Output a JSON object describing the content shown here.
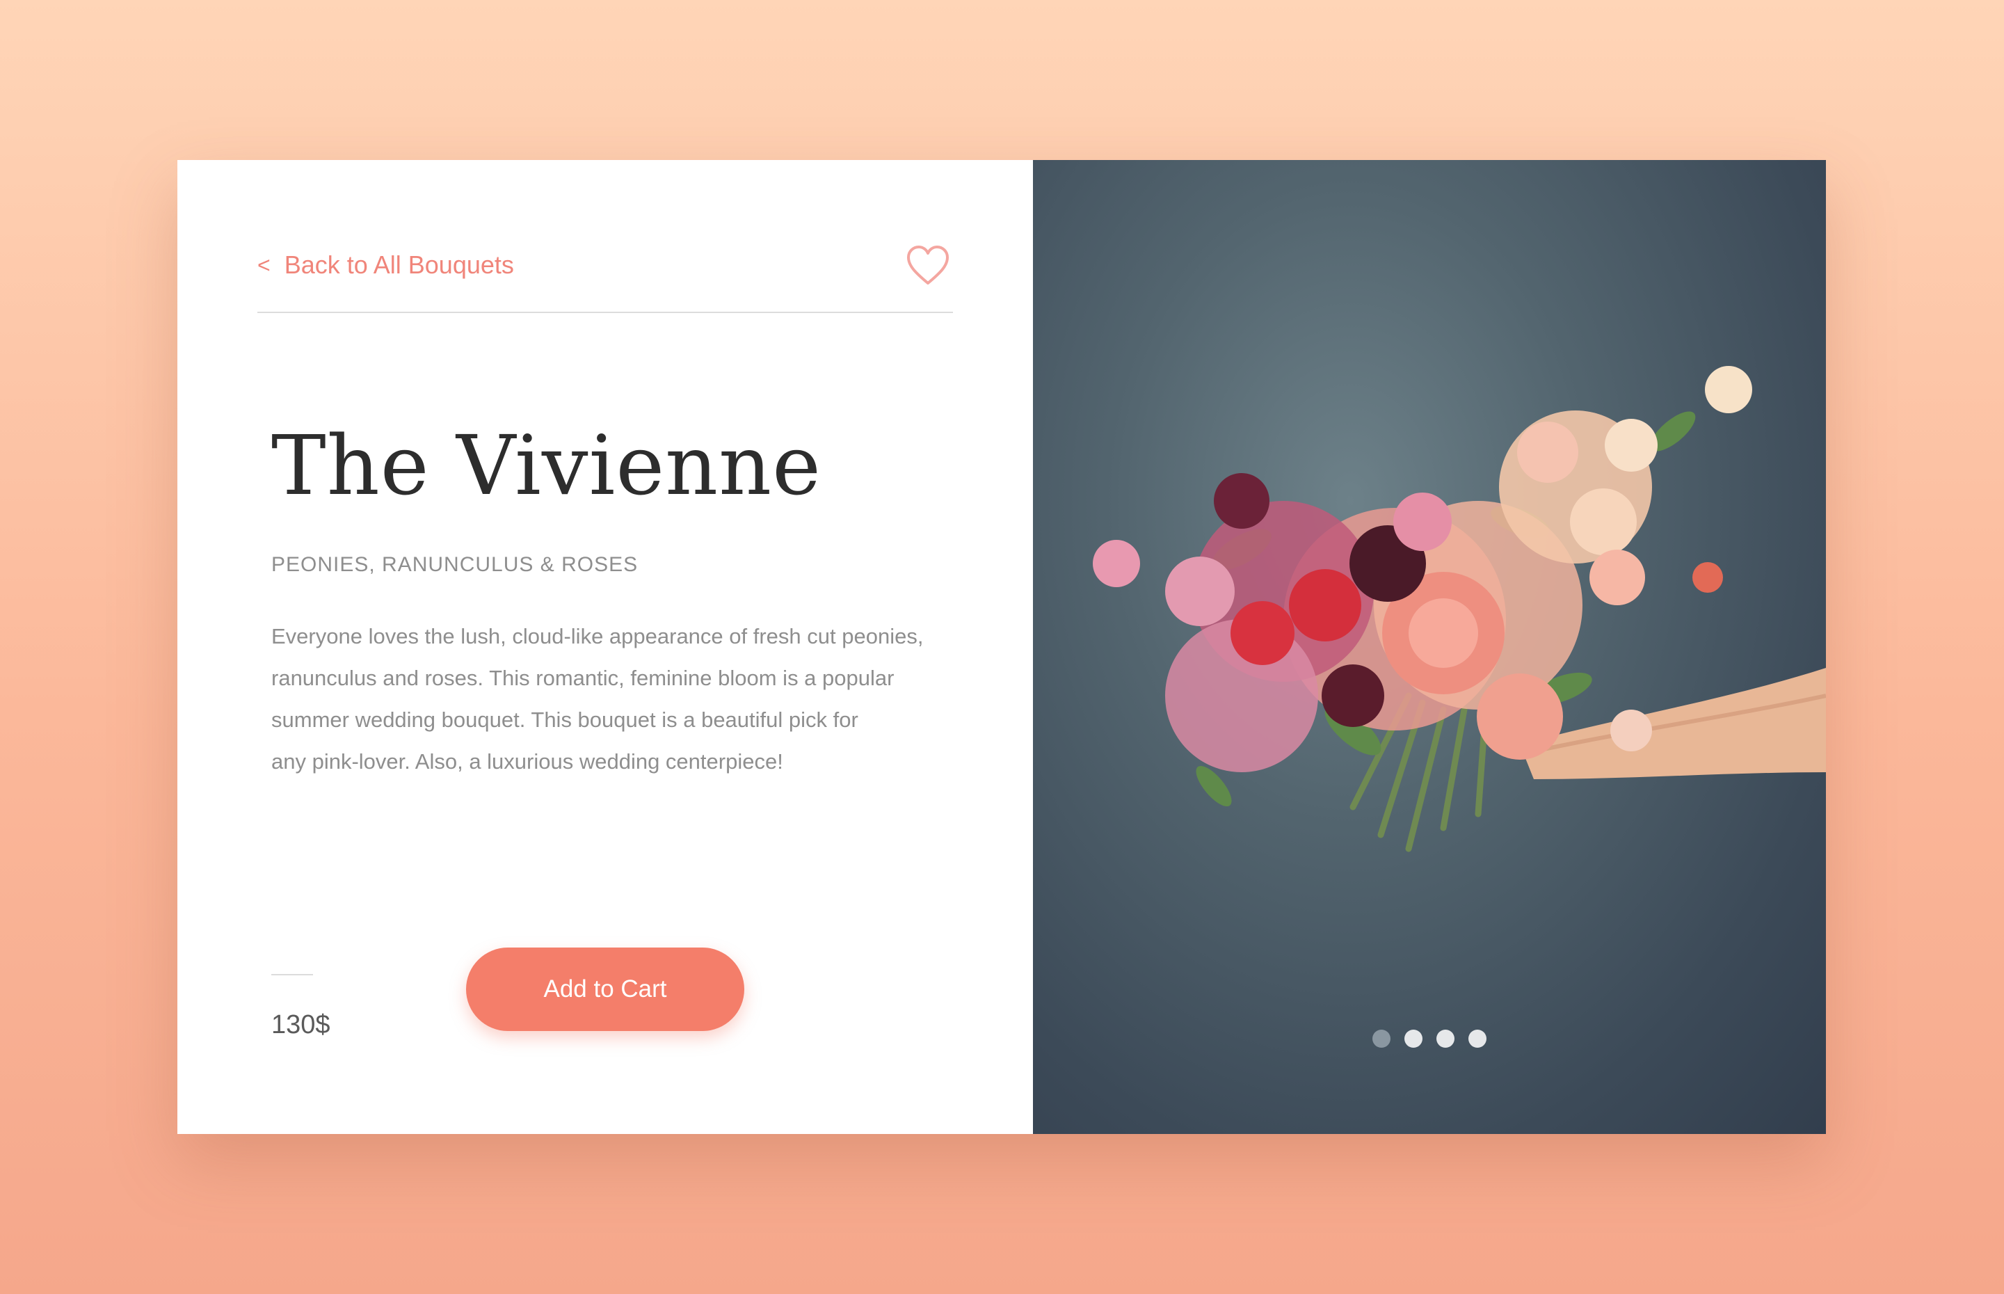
{
  "nav": {
    "back_chevron": "<",
    "back_label": "Back to All Bouquets"
  },
  "product": {
    "title": "The Vivienne",
    "subtitle": "PEONIES, RANUNCULUS & ROSES",
    "description_lines": [
      "Everyone loves the lush, cloud-like appearance of fresh cut peonies,",
      "ranunculus and roses. This romantic, feminine bloom is a popular",
      "summer wedding bouquet. This bouquet is a beautiful pick for",
      "any pink-lover. Also, a luxurious wedding centerpiece!"
    ],
    "price": "130$"
  },
  "actions": {
    "add_to_cart": "Add to Cart"
  },
  "icons": {
    "back": "chevron-left-icon",
    "favorite": "heart-icon"
  },
  "carousel": {
    "dots_count": 4,
    "active_index": 0
  },
  "colors": {
    "accent": "#f47e6a",
    "link": "#f0857a",
    "title": "#2d2d2d",
    "muted_text": "#8e8e8e",
    "photo_backdrop": "#4a5a66"
  }
}
